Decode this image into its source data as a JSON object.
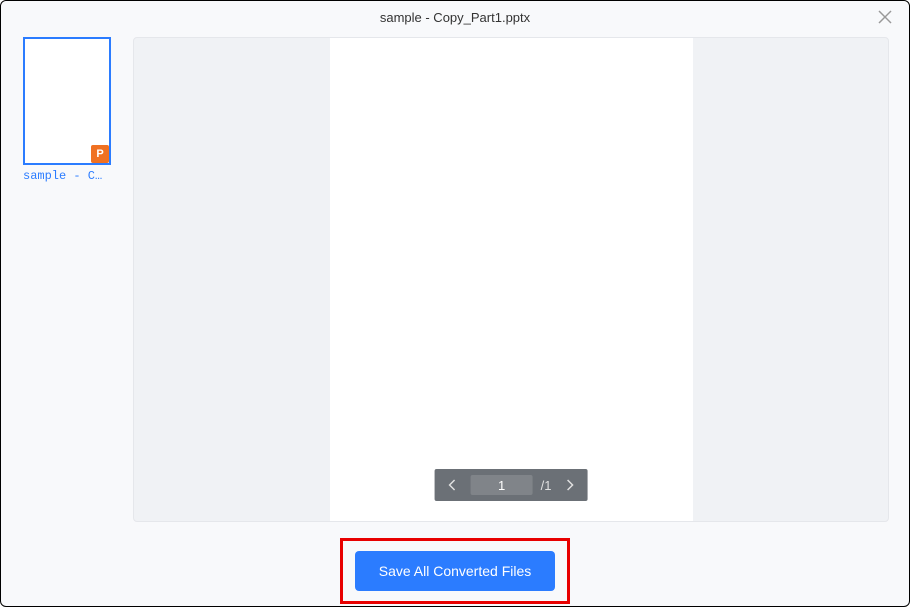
{
  "header": {
    "title": "sample - Copy_Part1.pptx"
  },
  "sidebar": {
    "thumbnail": {
      "badge": "P",
      "label": "sample - C…"
    }
  },
  "pagination": {
    "current": "1",
    "total": "/1"
  },
  "footer": {
    "save_label": "Save All Converted Files"
  }
}
